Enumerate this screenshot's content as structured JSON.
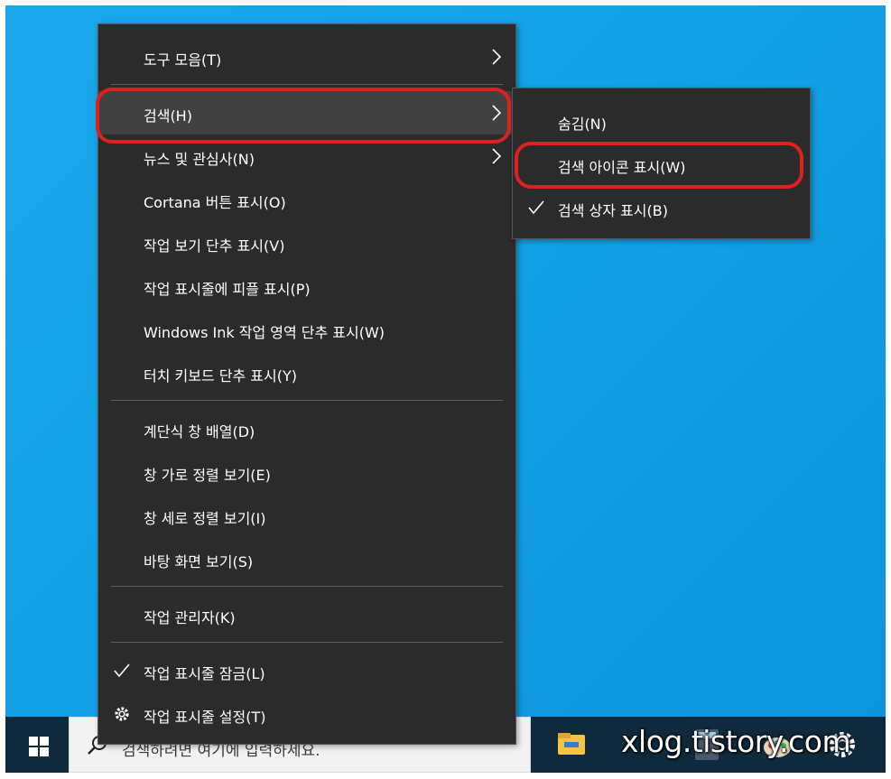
{
  "context_menu": {
    "items": [
      {
        "label": "도구 모음(T)",
        "submenu": true
      },
      {
        "label": "검색(H)",
        "submenu": true
      },
      {
        "label": "뉴스 및 관심사(N)",
        "submenu": true
      },
      {
        "label": "Cortana 버튼 표시(O)"
      },
      {
        "label": "작업 보기 단추 표시(V)"
      },
      {
        "label": "작업 표시줄에 피플 표시(P)"
      },
      {
        "label": "Windows Ink 작업 영역 단추 표시(W)"
      },
      {
        "label": "터치 키보드 단추 표시(Y)"
      },
      {
        "label": "계단식 창 배열(D)"
      },
      {
        "label": "창 가로 정렬 보기(E)"
      },
      {
        "label": "창 세로 정렬 보기(I)"
      },
      {
        "label": "바탕 화면 보기(S)"
      },
      {
        "label": "작업 관리자(K)"
      },
      {
        "label": "작업 표시줄 잠금(L)",
        "checked": true
      },
      {
        "label": "작업 표시줄 설정(T)",
        "icon": "gear-icon"
      }
    ]
  },
  "search_submenu": {
    "items": [
      {
        "label": "숨김(N)"
      },
      {
        "label": "검색 아이콘 표시(W)"
      },
      {
        "label": "검색 상자 표시(B)",
        "checked": true
      }
    ]
  },
  "taskbar": {
    "search_placeholder": "검색하려면 여기에 입력하세요."
  },
  "watermark": "xlog.tistory.com",
  "colors": {
    "desktop": "#13a2e6",
    "menu_bg": "#2b2b2b",
    "highlight": "#e0201f"
  }
}
